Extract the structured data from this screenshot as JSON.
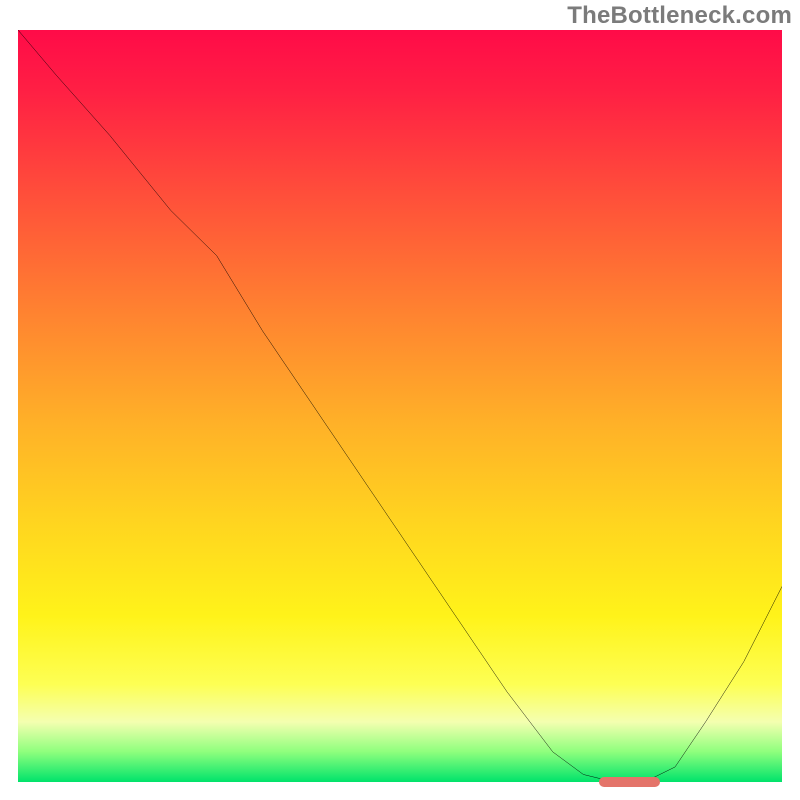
{
  "watermark": "TheBottleneck.com",
  "colors": {
    "gradient_top": "#ff0b48",
    "gradient_mid": "#ffd61f",
    "gradient_bottom": "#00e36b",
    "curve": "#000000",
    "axis": "#000000",
    "marker": "#e4746a"
  },
  "chart_data": {
    "type": "line",
    "title": "",
    "xlabel": "",
    "ylabel": "",
    "xlim": [
      0,
      100
    ],
    "ylim": [
      0,
      100
    ],
    "x": [
      0,
      5,
      12,
      20,
      26,
      32,
      40,
      48,
      56,
      64,
      70,
      74,
      78,
      82,
      86,
      90,
      95,
      100
    ],
    "values": [
      100,
      94,
      86,
      76,
      70,
      60,
      48,
      36,
      24,
      12,
      4,
      1,
      0,
      0,
      2,
      8,
      16,
      26
    ],
    "annotations": [
      {
        "kind": "flat-marker",
        "x_start": 76,
        "x_end": 84,
        "y": 0
      }
    ],
    "background": "vertical-gradient red→yellow→green"
  }
}
